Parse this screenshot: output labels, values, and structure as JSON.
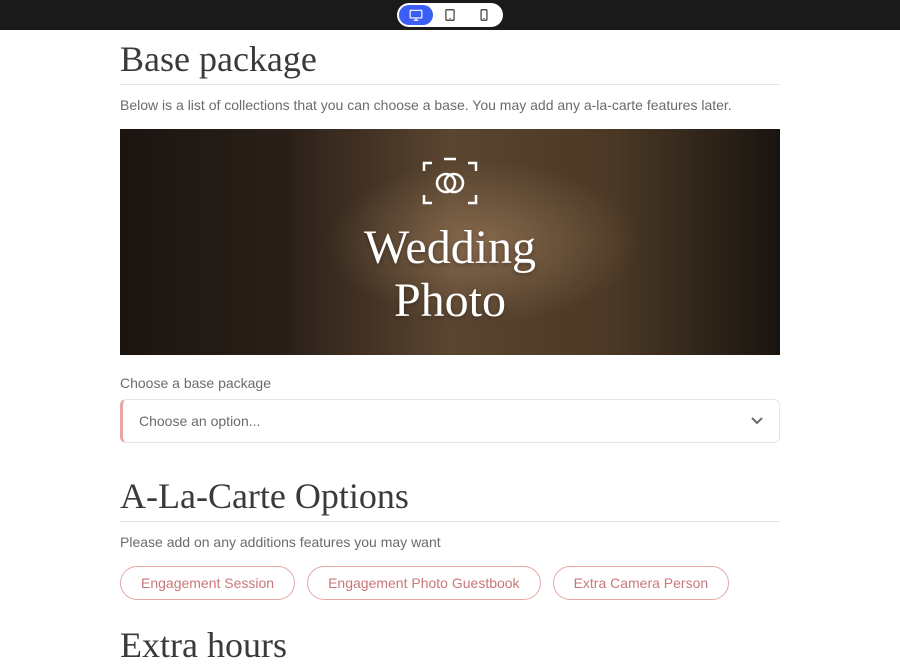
{
  "devices": {
    "desktop": "desktop",
    "tablet": "tablet",
    "mobile": "mobile"
  },
  "sections": {
    "base_package": {
      "title": "Base package",
      "description": "Below is a list of collections that you can choose a base. You may add any a-la-carte features later."
    },
    "hero": {
      "line1": "Wedding",
      "line2": "Photo"
    },
    "select": {
      "label": "Choose a base package",
      "placeholder": "Choose an option..."
    },
    "alacarte": {
      "title": "A-La-Carte Options",
      "description": "Please add on any additions features you may want",
      "options": [
        "Engagement Session",
        "Engagement Photo Guestbook",
        "Extra Camera Person"
      ]
    },
    "extra_hours": {
      "title": "Extra hours"
    }
  }
}
